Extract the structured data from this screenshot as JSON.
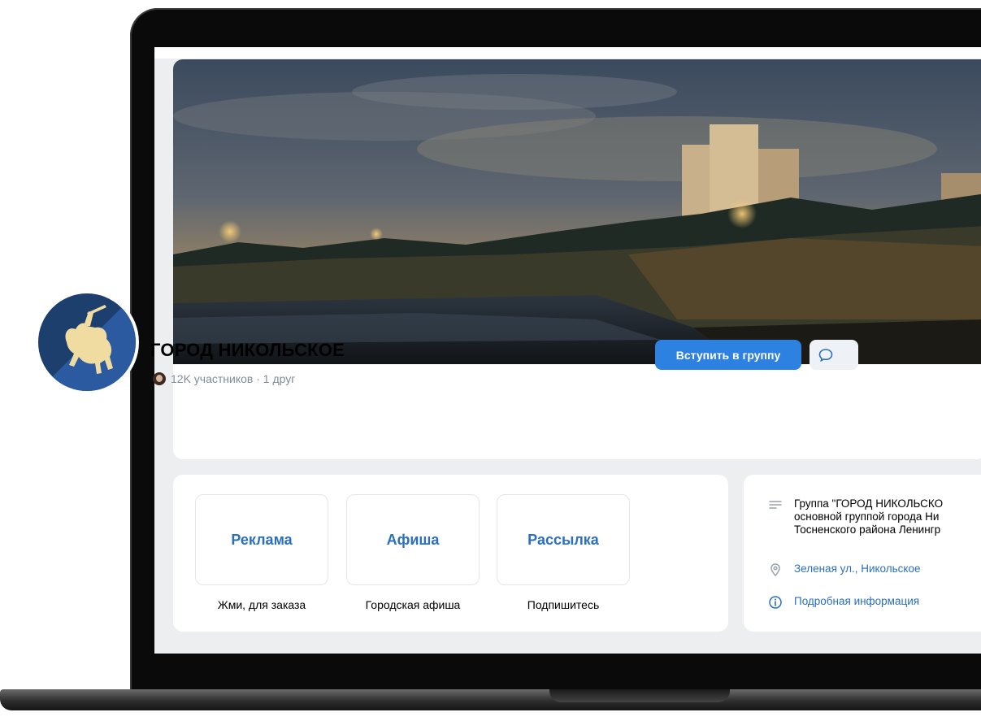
{
  "group": {
    "title": "ГОРОД НИКОЛЬСКОЕ",
    "members": "12K участников · 1 друг",
    "join_label": "Вступить в группу"
  },
  "links": [
    {
      "title": "Реклама",
      "caption": "Жми, для заказа"
    },
    {
      "title": "Афиша",
      "caption": "Городская афиша"
    },
    {
      "title": "Рассылка",
      "caption": "Подпишитесь"
    }
  ],
  "info": {
    "description_lines": [
      "Группа \"ГОРОД НИКОЛЬСКО",
      "основной группой города Ни",
      "Тосненского района Ленингр"
    ],
    "address": "Зеленая ул., Никольское",
    "details": "Подробная информация"
  },
  "icons": {
    "description": "lines-icon",
    "address": "location-pin-icon",
    "details": "info-icon",
    "message": "message-icon"
  },
  "colors": {
    "accent": "#2d81e0",
    "link": "#2a6fc0",
    "background": "#edeef0"
  }
}
